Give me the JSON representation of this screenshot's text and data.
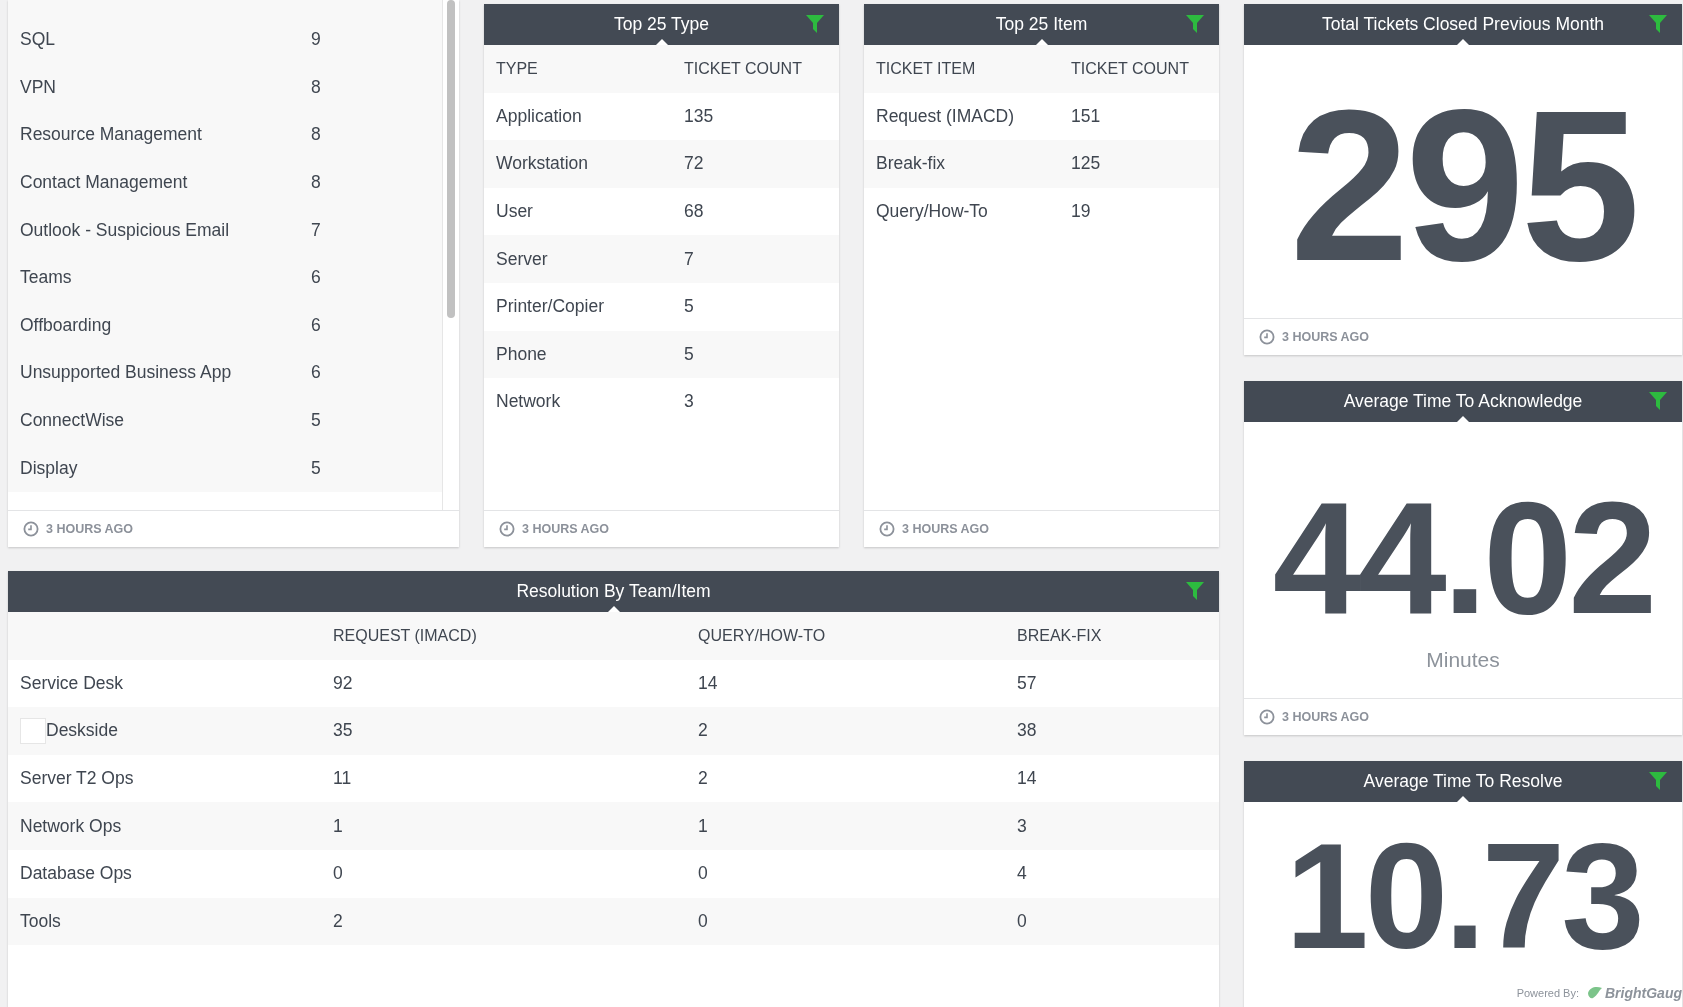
{
  "category_panel": {
    "rows": [
      {
        "name": "SQL",
        "count": "9"
      },
      {
        "name": "VPN",
        "count": "8"
      },
      {
        "name": "Resource Management",
        "count": "8"
      },
      {
        "name": "Contact Management",
        "count": "8"
      },
      {
        "name": "Outlook - Suspicious Email",
        "count": "7"
      },
      {
        "name": "Teams",
        "count": "6"
      },
      {
        "name": "Offboarding",
        "count": "6"
      },
      {
        "name": "Unsupported Business App",
        "count": "6"
      },
      {
        "name": "ConnectWise",
        "count": "5"
      },
      {
        "name": "Display",
        "count": "5"
      }
    ],
    "footer": "3 HOURS AGO"
  },
  "type_panel": {
    "title": "Top 25 Type",
    "columns": [
      "TYPE",
      "TICKET COUNT"
    ],
    "rows": [
      [
        "Application",
        "135"
      ],
      [
        "Workstation",
        "72"
      ],
      [
        "User",
        "68"
      ],
      [
        "Server",
        "7"
      ],
      [
        "Printer/Copier",
        "5"
      ],
      [
        "Phone",
        "5"
      ],
      [
        "Network",
        "3"
      ]
    ],
    "footer": "3 HOURS AGO"
  },
  "item_panel": {
    "title": "Top 25 Item",
    "columns": [
      "TICKET ITEM",
      "TICKET COUNT"
    ],
    "rows": [
      [
        "Request (IMACD)",
        "151"
      ],
      [
        "Break-fix",
        "125"
      ],
      [
        "Query/How-To",
        "19"
      ]
    ],
    "footer": "3 HOURS AGO"
  },
  "resolution_panel": {
    "title": "Resolution By Team/Item",
    "columns": [
      "REQUEST (IMACD)",
      "QUERY/HOW-TO",
      "BREAK-FIX"
    ],
    "rows": [
      {
        "team": "Service Desk",
        "kind": "plain",
        "values": [
          "92",
          "14",
          "57"
        ]
      },
      {
        "team": "Deskside",
        "kind": "boxed",
        "values": [
          "35",
          "2",
          "38"
        ]
      },
      {
        "team": "Server T2 Ops",
        "kind": "plain",
        "values": [
          "11",
          "2",
          "14"
        ]
      },
      {
        "team": "Network Ops",
        "kind": "plain",
        "values": [
          "1",
          "1",
          "3"
        ]
      },
      {
        "team": "Database Ops",
        "kind": "plain",
        "values": [
          "0",
          "0",
          "4"
        ]
      },
      {
        "team": "Tools",
        "kind": "plain",
        "values": [
          "2",
          "0",
          "0"
        ]
      }
    ]
  },
  "metrics": [
    {
      "title": "Total Tickets Closed Previous Month",
      "value": "295",
      "footer": "3 HOURS AGO"
    },
    {
      "title": "Average Time To Acknowledge",
      "value": "44.02",
      "unit": "Minutes",
      "footer": "3 HOURS AGO"
    },
    {
      "title": "Average Time To Resolve",
      "value": "10.73"
    }
  ],
  "branding": {
    "label": "Powered By:",
    "brand": "BrightGaug"
  }
}
